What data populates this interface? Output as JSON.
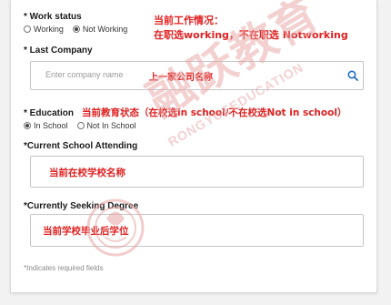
{
  "work_status": {
    "label": "* Work status",
    "options": [
      "Working",
      "Not Working"
    ],
    "selected": "Not Working",
    "annotation_line1": "当前工作情况：",
    "annotation_line2": "在职选working，不在职选 Notworking"
  },
  "last_company": {
    "label": "* Last Company",
    "placeholder": "Enter company name",
    "value": "",
    "annotation": "上一家公司名称"
  },
  "education": {
    "label": "* Education",
    "annotation": "当前教育状态（在校选in school/不在校选Not in school）",
    "options": [
      "In School",
      "Not In School"
    ],
    "selected": "In School"
  },
  "current_school": {
    "label": "*Current School Attending",
    "value": "",
    "annotation": "当前在校学校名称"
  },
  "seeking_degree": {
    "label": "*Currently Seeking Degree",
    "value": "",
    "annotation": "当前学校毕业后学位"
  },
  "required_note": "*Indicates required fields",
  "watermark": {
    "main_text": "融跃教育",
    "sub_text": "RONGYUEEDUCATION"
  },
  "colors": {
    "annotation": "#e02020",
    "search_icon": "#1f6fc5",
    "watermark": "#e8a5a5"
  }
}
